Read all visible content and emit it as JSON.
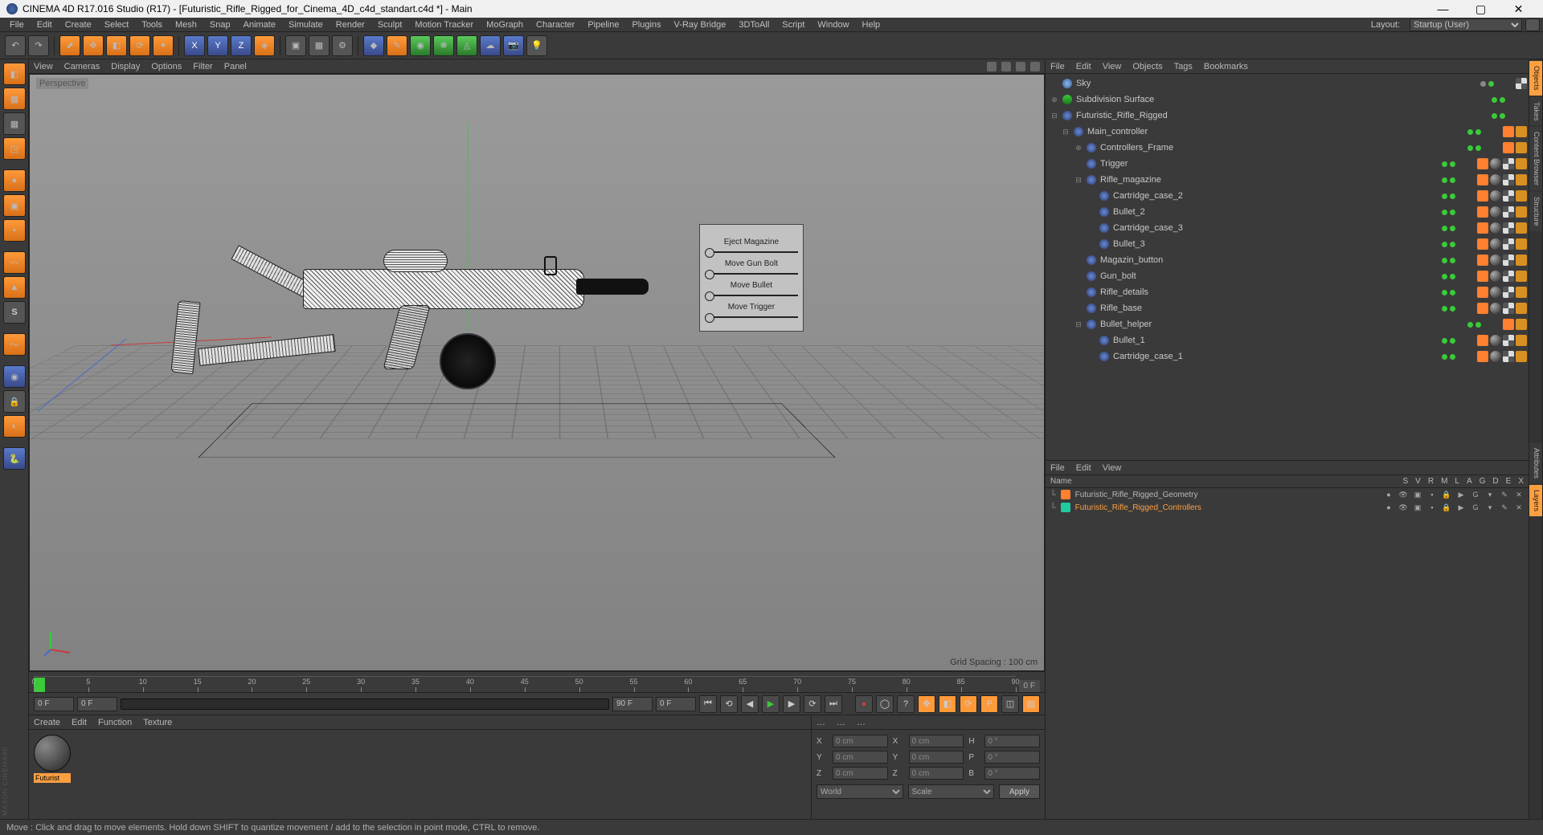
{
  "title": "CINEMA 4D R17.016 Studio (R17) - [Futuristic_Rifle_Rigged_for_Cinema_4D_c4d_standart.c4d *] - Main",
  "menus": [
    "File",
    "Edit",
    "Create",
    "Select",
    "Tools",
    "Mesh",
    "Snap",
    "Animate",
    "Simulate",
    "Render",
    "Sculpt",
    "Motion Tracker",
    "MoGraph",
    "Character",
    "Pipeline",
    "Plugins",
    "V-Ray Bridge",
    "3DToAll",
    "Script",
    "Window",
    "Help"
  ],
  "layout_label": "Layout:",
  "layout_value": "Startup (User)",
  "vp_menus": [
    "View",
    "Cameras",
    "Display",
    "Options",
    "Filter",
    "Panel"
  ],
  "vp_label": "Perspective",
  "vp_footer": "Grid Spacing : 100 cm",
  "ctrl_labels": [
    "Eject Magazine",
    "Move Gun Bolt",
    "Move Bullet",
    "Move Trigger"
  ],
  "timeline": {
    "start": 0,
    "end": 90,
    "ticks": [
      0,
      5,
      10,
      15,
      20,
      25,
      30,
      35,
      40,
      45,
      50,
      55,
      60,
      65,
      70,
      75,
      80,
      85,
      90
    ],
    "end_label": "0 F"
  },
  "playback": {
    "start": "0 F",
    "rfrom": "0 F",
    "rto": "90 F",
    "cur": "0 F"
  },
  "mat_menus": [
    "Create",
    "Edit",
    "Function",
    "Texture"
  ],
  "mat_name": "Futurist",
  "coord": {
    "hdrs": [
      "…",
      "…",
      "…"
    ],
    "rows": [
      {
        "l": "X",
        "v": "0 cm",
        "l2": "X",
        "v2": "0 cm",
        "l3": "H",
        "v3": "0 °"
      },
      {
        "l": "Y",
        "v": "0 cm",
        "l2": "Y",
        "v2": "0 cm",
        "l3": "P",
        "v3": "0 °"
      },
      {
        "l": "Z",
        "v": "0 cm",
        "l2": "Z",
        "v2": "0 cm",
        "l3": "B",
        "v3": "0 °"
      }
    ],
    "sel1": "World",
    "sel2": "Scale",
    "apply": "Apply"
  },
  "obj_menus": [
    "File",
    "Edit",
    "View",
    "Objects",
    "Tags",
    "Bookmarks"
  ],
  "objects": [
    {
      "ind": 0,
      "exp": "",
      "ic": "sky",
      "nm": "Sky",
      "dots": [
        "gr",
        "g"
      ],
      "tags": [
        "chk"
      ]
    },
    {
      "ind": 0,
      "exp": "⊕",
      "ic": "sds",
      "nm": "Subdivision Surface",
      "dots": [
        "g",
        "g"
      ],
      "tags": []
    },
    {
      "ind": 0,
      "exp": "⊟",
      "ic": "null",
      "nm": "Futuristic_Rifle_Rigged",
      "dots": [
        "g",
        "g"
      ],
      "tags": []
    },
    {
      "ind": 1,
      "exp": "⊟",
      "ic": "null",
      "nm": "Main_controller",
      "dots": [
        "g",
        "g"
      ],
      "tags": [
        "orange",
        "star"
      ]
    },
    {
      "ind": 2,
      "exp": "⊕",
      "ic": "null",
      "nm": "Controllers_Frame",
      "dots": [
        "g",
        "g"
      ],
      "tags": [
        "orange",
        "star"
      ]
    },
    {
      "ind": 2,
      "exp": "",
      "ic": "null",
      "nm": "Trigger",
      "dots": [
        "g",
        "g"
      ],
      "tags": [
        "orange",
        "sph",
        "chk",
        "star"
      ]
    },
    {
      "ind": 2,
      "exp": "⊟",
      "ic": "null",
      "nm": "Rifle_magazine",
      "dots": [
        "g",
        "g"
      ],
      "tags": [
        "orange",
        "sph",
        "chk",
        "star"
      ]
    },
    {
      "ind": 3,
      "exp": "",
      "ic": "null",
      "nm": "Cartridge_case_2",
      "dots": [
        "g",
        "g"
      ],
      "tags": [
        "orange",
        "sph",
        "chk",
        "star"
      ]
    },
    {
      "ind": 3,
      "exp": "",
      "ic": "null",
      "nm": "Bullet_2",
      "dots": [
        "g",
        "g"
      ],
      "tags": [
        "orange",
        "sph",
        "chk",
        "star"
      ]
    },
    {
      "ind": 3,
      "exp": "",
      "ic": "null",
      "nm": "Cartridge_case_3",
      "dots": [
        "g",
        "g"
      ],
      "tags": [
        "orange",
        "sph",
        "chk",
        "star"
      ]
    },
    {
      "ind": 3,
      "exp": "",
      "ic": "null",
      "nm": "Bullet_3",
      "dots": [
        "g",
        "g"
      ],
      "tags": [
        "orange",
        "sph",
        "chk",
        "star"
      ]
    },
    {
      "ind": 2,
      "exp": "",
      "ic": "null",
      "nm": "Magazin_button",
      "dots": [
        "g",
        "g"
      ],
      "tags": [
        "orange",
        "sph",
        "chk",
        "star"
      ]
    },
    {
      "ind": 2,
      "exp": "",
      "ic": "null",
      "nm": "Gun_bolt",
      "dots": [
        "g",
        "g"
      ],
      "tags": [
        "orange",
        "sph",
        "chk",
        "star"
      ]
    },
    {
      "ind": 2,
      "exp": "",
      "ic": "null",
      "nm": "Rifle_details",
      "dots": [
        "g",
        "g"
      ],
      "tags": [
        "orange",
        "sph",
        "chk",
        "star"
      ]
    },
    {
      "ind": 2,
      "exp": "",
      "ic": "null",
      "nm": "Rifle_base",
      "dots": [
        "g",
        "g"
      ],
      "tags": [
        "orange",
        "sph",
        "chk",
        "star"
      ]
    },
    {
      "ind": 2,
      "exp": "⊟",
      "ic": "null",
      "nm": "Bullet_helper",
      "dots": [
        "g",
        "g"
      ],
      "tags": [
        "orange",
        "star"
      ]
    },
    {
      "ind": 3,
      "exp": "",
      "ic": "null",
      "nm": "Bullet_1",
      "dots": [
        "g",
        "g"
      ],
      "tags": [
        "orange",
        "sph",
        "chk",
        "star"
      ]
    },
    {
      "ind": 3,
      "exp": "",
      "ic": "null",
      "nm": "Cartridge_case_1",
      "dots": [
        "g",
        "g"
      ],
      "tags": [
        "orange",
        "sph",
        "chk",
        "star"
      ]
    }
  ],
  "lay_menus": [
    "File",
    "Edit",
    "View"
  ],
  "lay_name_hdr": "Name",
  "lay_cols": [
    "S",
    "V",
    "R",
    "M",
    "L",
    "A",
    "G",
    "D",
    "E",
    "X"
  ],
  "layers": [
    {
      "color": "#ff8030",
      "nm": "Futuristic_Rifle_Rigged_Geometry",
      "sel": false
    },
    {
      "color": "#20caa0",
      "nm": "Futuristic_Rifle_Rigged_Controllers",
      "sel": true
    }
  ],
  "right_tabs_top": [
    "Objects",
    "Takes",
    "Content Browser",
    "Structure"
  ],
  "right_tabs_bot": [
    "Attributes",
    "Layers"
  ],
  "status": "Move : Click and drag to move elements. Hold down SHIFT to quantize movement / add to the selection in point mode, CTRL to remove.",
  "brand": "MAXON CINEMA4D"
}
